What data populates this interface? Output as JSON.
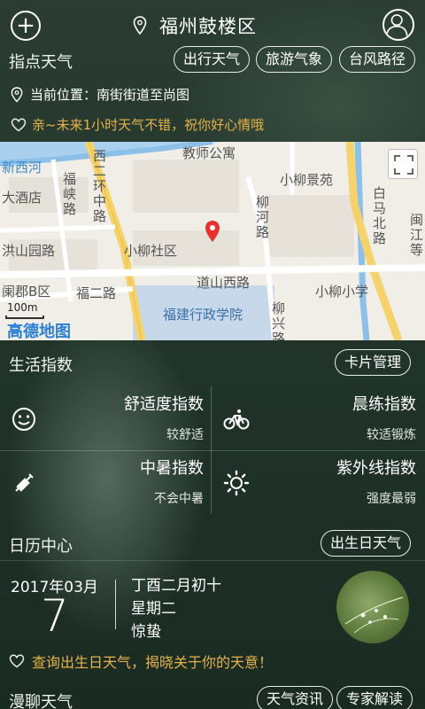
{
  "header": {
    "city": "福州鼓楼区",
    "icons": {
      "add": "plus-circle-icon",
      "location": "location-pin-icon",
      "user": "user-avatar-icon"
    }
  },
  "weather_section": {
    "title": "指点天气",
    "buttons": [
      "出行天气",
      "旅游气象",
      "台风路径"
    ],
    "current_location": "当前位置：南街街道至尚图",
    "tip": "亲~未来1小时天气不错，祝你好心情哦"
  },
  "map": {
    "labels": [
      "新西河",
      "西二环中路",
      "福峡路",
      "大酒店",
      "洪山园路",
      "阑郡B区",
      "福二路",
      "小柳社区",
      "教师公寓",
      "小柳景苑",
      "柳河路",
      "白马北路",
      "道山西路",
      "小柳小学",
      "福建行政学院",
      "柳兴路",
      "闽江等"
    ],
    "scale": "100m",
    "provider": "高德地图"
  },
  "life_index": {
    "title": "生活指数",
    "manage_button": "卡片管理",
    "items": [
      {
        "name": "舒适度指数",
        "value": "较舒适",
        "icon": "smiley-icon"
      },
      {
        "name": "晨练指数",
        "value": "较适锻炼",
        "icon": "bicycle-icon"
      },
      {
        "name": "中暑指数",
        "value": "不会中暑",
        "icon": "syringe-icon"
      },
      {
        "name": "紫外线指数",
        "value": "强度最弱",
        "icon": "sun-icon"
      }
    ]
  },
  "calendar": {
    "title": "日历中心",
    "birthday_button": "出生日天气",
    "year_month": "2017年03月",
    "day": "7",
    "lunar_date": "丁酉二月初十",
    "weekday": "星期二",
    "solar_term": "惊蛰",
    "birthday_tip": "查询出生日天气，揭晓关于你的天意！"
  },
  "chat_section": {
    "title": "漫聊天气",
    "buttons": [
      "天气资讯",
      "专家解读"
    ]
  }
}
